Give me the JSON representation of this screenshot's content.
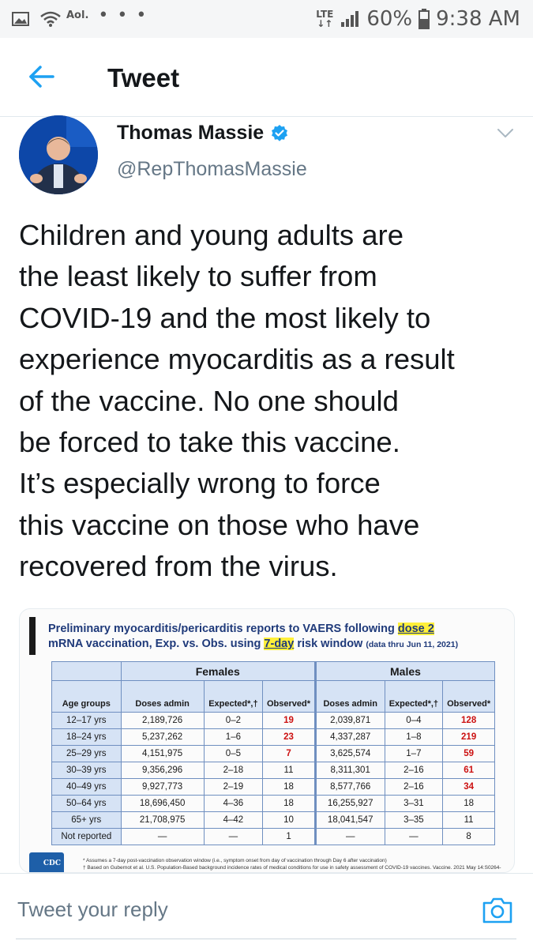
{
  "status_bar": {
    "network_label": "LTE",
    "carrier": "Aol.",
    "more": "• • •",
    "battery": "60%",
    "time": "9:38 AM"
  },
  "header": {
    "title": "Tweet",
    "back_icon": "arrow-left-icon"
  },
  "tweet": {
    "author_name": "Thomas Massie",
    "handle": "@RepThomasMassie",
    "verified_icon": "verified-badge-icon",
    "text": "Children and young adults are\nthe least likely to suffer from\nCOVID-19 and the most likely to\nexperience myocarditis as a result\nof the vaccine. No one should\nbe forced to take this vaccine.\nIt’s especially wrong to force\nthis vaccine on those who have\nrecovered from the virus."
  },
  "media": {
    "title_line1_prefix": "Preliminary myocarditis/pericarditis reports to VAERS following ",
    "title_line1_highlight": "dose 2",
    "title_line2_prefix": "mRNA vaccination, Exp. vs. Obs. using ",
    "title_line2_highlight": "7-day",
    "title_line2_suffix": " risk window ",
    "title_line2_small": "(data thru Jun 11, 2021)",
    "group_females": "Females",
    "group_males": "Males",
    "col_age": "Age groups",
    "col_doses": "Doses admin",
    "col_expected": "Expected*,†",
    "col_observed": "Observed*",
    "rows": [
      {
        "age": "12–17 yrs",
        "f_doses": "2,189,726",
        "f_exp": "0–2",
        "f_obs": "19",
        "m_doses": "2,039,871",
        "m_exp": "0–4",
        "m_obs": "128"
      },
      {
        "age": "18–24 yrs",
        "f_doses": "5,237,262",
        "f_exp": "1–6",
        "f_obs": "23",
        "m_doses": "4,337,287",
        "m_exp": "1–8",
        "m_obs": "219"
      },
      {
        "age": "25–29 yrs",
        "f_doses": "4,151,975",
        "f_exp": "0–5",
        "f_obs": "7",
        "m_doses": "3,625,574",
        "m_exp": "1–7",
        "m_obs": "59"
      },
      {
        "age": "30–39 yrs",
        "f_doses": "9,356,296",
        "f_exp": "2–18",
        "f_obs": "11",
        "m_doses": "8,311,301",
        "m_exp": "2–16",
        "m_obs": "61"
      },
      {
        "age": "40–49 yrs",
        "f_doses": "9,927,773",
        "f_exp": "2–19",
        "f_obs": "18",
        "m_doses": "8,577,766",
        "m_exp": "2–16",
        "m_obs": "34"
      },
      {
        "age": "50–64 yrs",
        "f_doses": "18,696,450",
        "f_exp": "4–36",
        "f_obs": "18",
        "m_doses": "16,255,927",
        "m_exp": "3–31",
        "m_obs": "18"
      },
      {
        "age": "65+ yrs",
        "f_doses": "21,708,975",
        "f_exp": "4–42",
        "f_obs": "10",
        "m_doses": "18,041,547",
        "m_exp": "3–35",
        "m_obs": "11"
      },
      {
        "age": "Not reported",
        "f_doses": "—",
        "f_exp": "—",
        "f_obs": "1",
        "m_doses": "—",
        "m_exp": "—",
        "m_obs": "8"
      }
    ],
    "red_flags": [
      {
        "f": true,
        "m": true
      },
      {
        "f": true,
        "m": true
      },
      {
        "f": true,
        "m": true
      },
      {
        "f": false,
        "m": true
      },
      {
        "f": false,
        "m": true
      },
      {
        "f": false,
        "m": false
      },
      {
        "f": false,
        "m": false
      },
      {
        "f": false,
        "m": false
      }
    ],
    "footnote_1": "* Assumes a 7-day post-vaccination observation window (i.e., symptom onset from day of vaccination through Day 6 after vaccination)",
    "footnote_2": "† Based on Gubernot et al. U.S. Population-Based background incidence rates of medical conditions for use in safety assessment of COVID-19 vaccines. Vaccine. 2021 May 14:S0264-",
    "logo_text": "CDC"
  },
  "reply": {
    "placeholder": "Tweet your reply",
    "camera_icon": "camera-icon"
  },
  "colors": {
    "twitter_blue": "#1da1f2",
    "observed_red": "#cc1111",
    "table_header": "#d6e3f5"
  }
}
